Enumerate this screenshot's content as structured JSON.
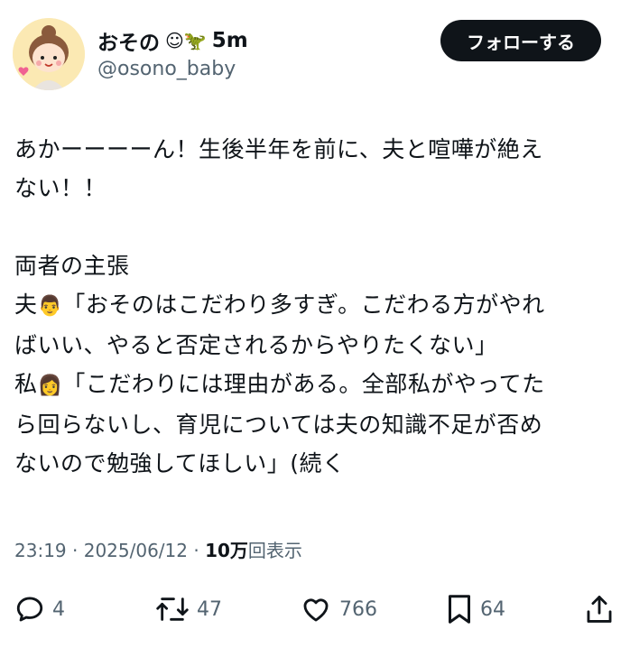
{
  "user": {
    "display_name": "おその",
    "name_emojis": "☺🦖",
    "time_ago": "5m",
    "handle": "@osono_baby"
  },
  "follow_button": {
    "label": "フォローする"
  },
  "tweet": {
    "lines": [
      "あかーーーーん！生後半年を前に、夫と喧嘩が絶え",
      "ない！！",
      "",
      "両者の主張",
      "夫",
      "「おそのはこだわり多すぎ。こだわる方がやれ",
      "ばいい、やると否定されるからやりたくない」",
      "私",
      "「こだわりには理由がある。全部私がやってた",
      "ら回らないし、育児については夫の知識不足が否め",
      "ないので勉強してほしい」(続く"
    ],
    "husband_emoji": "👨",
    "wife_emoji": "👩"
  },
  "meta": {
    "time": "23:19",
    "date": "2025/06/12",
    "views_count": "10万",
    "views_label": "回表示"
  },
  "actions": {
    "replies": "4",
    "retweets": "47",
    "likes": "766",
    "bookmarks": "64"
  },
  "icons": [
    "reply-icon",
    "retweet-icon",
    "like-icon",
    "bookmark-icon",
    "share-icon"
  ]
}
